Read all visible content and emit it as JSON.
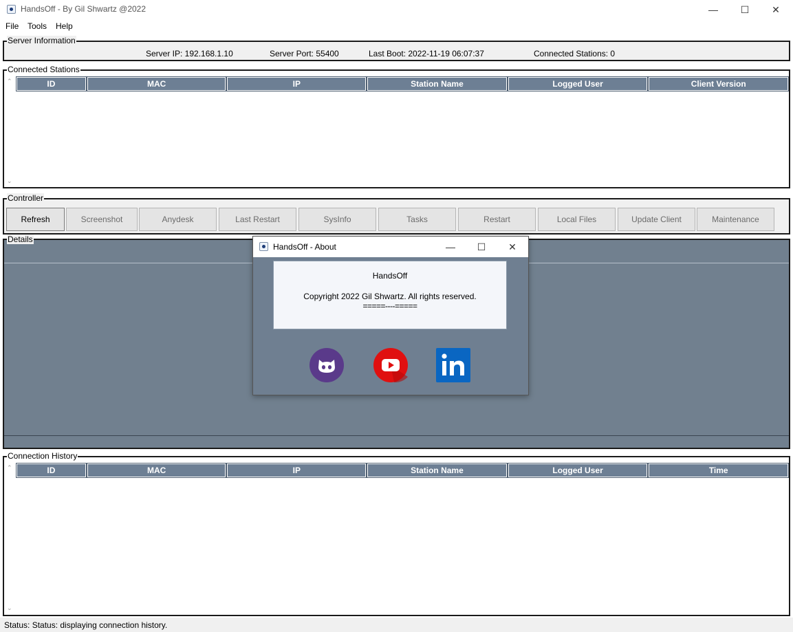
{
  "window": {
    "title": "HandsOff - By Gil Shwartz @2022",
    "minimize": "—",
    "maximize": "☐",
    "close": "✕"
  },
  "menu": [
    "File",
    "Tools",
    "Help"
  ],
  "server_info": {
    "label": "Server Information",
    "server_ip": "Server IP: 192.168.1.10",
    "server_port": "Server Port: 55400",
    "last_boot": "Last Boot: 2022-11-19 06:07:37",
    "connected_stations": "Connected Stations: 0"
  },
  "connected_stations": {
    "label": "Connected Stations",
    "columns": [
      "ID",
      "MAC",
      "IP",
      "Station Name",
      "Logged User",
      "Client Version"
    ],
    "rows": []
  },
  "controller": {
    "label": "Controller",
    "buttons": [
      "Refresh",
      "Screenshot",
      "Anydesk",
      "Last Restart",
      "SysInfo",
      "Tasks",
      "Restart",
      "Local Files",
      "Update Client",
      "Maintenance"
    ]
  },
  "details": {
    "label": "Details"
  },
  "about_dialog": {
    "title": "HandsOff - About",
    "app_name": "HandsOff",
    "copyright": "Copyright 2022 Gil Shwartz. All rights reserved.",
    "separator": "=====----=====",
    "minimize": "—",
    "maximize": "☐",
    "close": "✕",
    "links": [
      {
        "icon": "github-icon",
        "color": "#5a3a8a"
      },
      {
        "icon": "youtube-icon",
        "color": "#e01010"
      },
      {
        "icon": "linkedin-icon",
        "color": "#0a66c2"
      }
    ]
  },
  "connection_history": {
    "label": "Connection History",
    "columns": [
      "ID",
      "MAC",
      "IP",
      "Station Name",
      "Logged User",
      "Time"
    ],
    "rows": []
  },
  "status": "Status: Status: displaying connection history."
}
